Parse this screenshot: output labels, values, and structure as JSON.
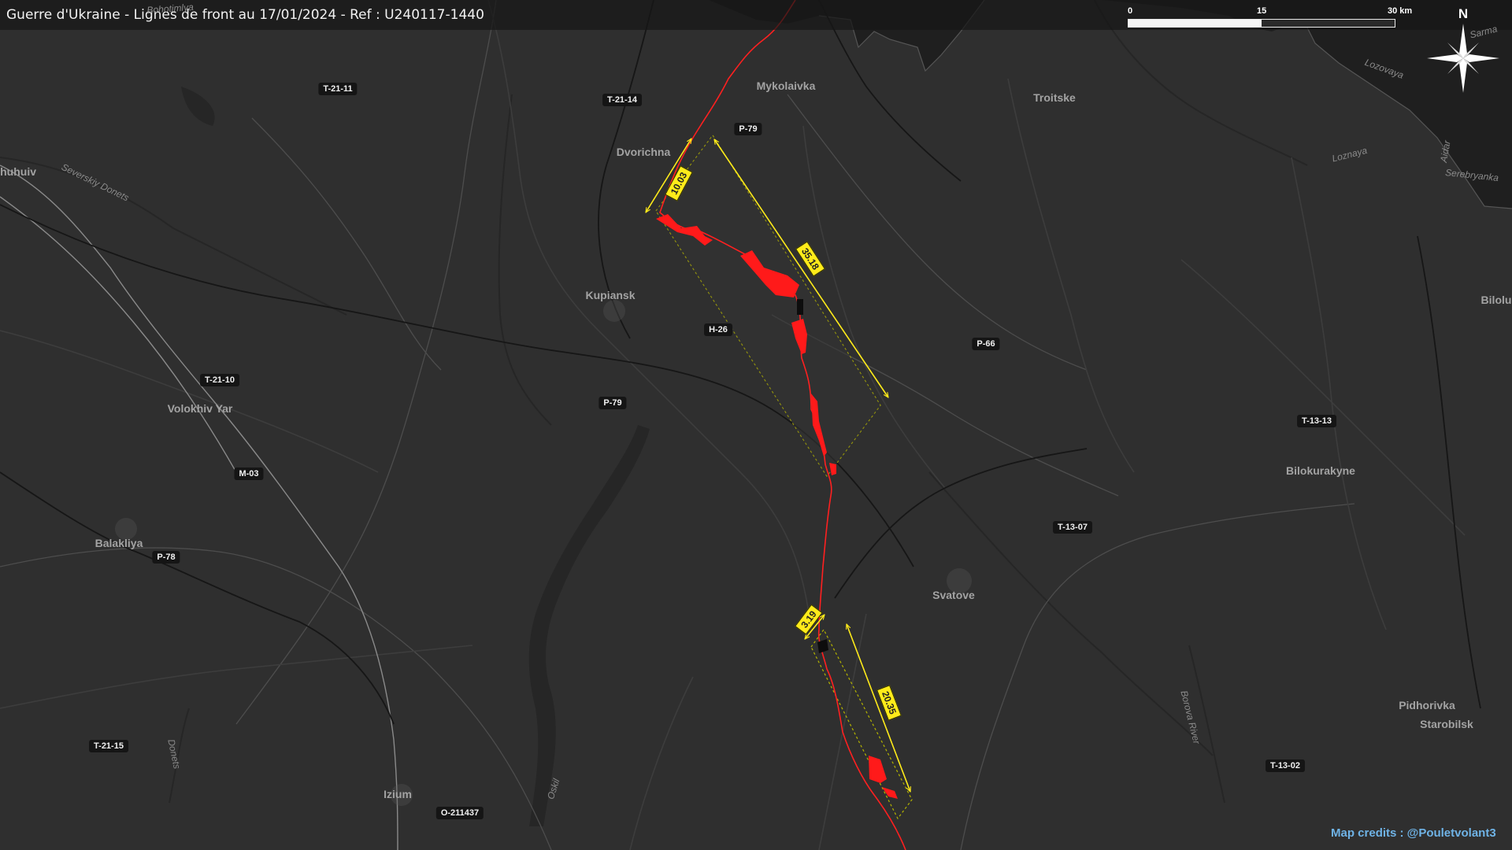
{
  "header": {
    "title": "Guerre d'Ukraine - Lignes de front au 17/01/2024 - Ref : U240117-1440"
  },
  "scale": {
    "labels": [
      "0",
      "15",
      "30 km"
    ],
    "filled_fraction": 0.5
  },
  "compass": {
    "north_label": "N",
    "icon": "compass-rose-icon"
  },
  "colors": {
    "background": "#2f2f2f",
    "front_line": "#ff2020",
    "measure": "#ffeb1a",
    "credits": "#6fb3e6"
  },
  "places": [
    {
      "id": "mykolaivka",
      "name": "Mykolaivka"
    },
    {
      "id": "troitske",
      "name": "Troitske"
    },
    {
      "id": "dvorichna",
      "name": "Dvorichna"
    },
    {
      "id": "kupiansk",
      "name": "Kupiansk"
    },
    {
      "id": "volokhiv-yar",
      "name": "Volokhiv Yar"
    },
    {
      "id": "balakliya",
      "name": "Balakliya"
    },
    {
      "id": "izium",
      "name": "Izium"
    },
    {
      "id": "svatove",
      "name": "Svatove"
    },
    {
      "id": "bilokurakyne",
      "name": "Bilokurakyne"
    },
    {
      "id": "pidhorivka",
      "name": "Pidhorivka"
    },
    {
      "id": "starobilsk",
      "name": "Starobilsk"
    },
    {
      "id": "chuhuiv",
      "name": "Chuhuiv"
    },
    {
      "id": "bilolutsk",
      "name": "Bilolu"
    }
  ],
  "rivers": [
    {
      "id": "seversky-donets",
      "name": "Severskiy Donets"
    },
    {
      "id": "lozovaya",
      "name": "Lozovaya"
    },
    {
      "id": "loznaya",
      "name": "Loznaya"
    },
    {
      "id": "aidar",
      "name": "Aidar"
    },
    {
      "id": "serebryanka",
      "name": "Serebryanka"
    },
    {
      "id": "sarma",
      "name": "Sarma"
    },
    {
      "id": "borova",
      "name": "Borova River"
    },
    {
      "id": "oskil",
      "name": "Oskil"
    },
    {
      "id": "donets",
      "name": "Donets"
    },
    {
      "id": "bohotimlya",
      "name": "Bohotimlya"
    }
  ],
  "roads": [
    {
      "id": "t-21-11",
      "label": "T-21-11"
    },
    {
      "id": "t-21-14",
      "label": "T-21-14"
    },
    {
      "id": "p-79-north",
      "label": "P-79"
    },
    {
      "id": "h-26",
      "label": "H-26"
    },
    {
      "id": "p-79-south",
      "label": "P-79"
    },
    {
      "id": "p-66",
      "label": "P-66"
    },
    {
      "id": "t-21-10",
      "label": "T-21-10"
    },
    {
      "id": "m-03",
      "label": "M-03"
    },
    {
      "id": "p-78",
      "label": "P-78"
    },
    {
      "id": "t-21-15",
      "label": "T-21-15"
    },
    {
      "id": "o-211437",
      "label": "O-211437"
    },
    {
      "id": "t-13-13",
      "label": "T-13-13"
    },
    {
      "id": "t-13-07",
      "label": "T-13-07"
    },
    {
      "id": "t-13-02",
      "label": "T-13-02"
    }
  ],
  "measurements": [
    {
      "id": "m-north-width",
      "value": "10.03",
      "unit": "km"
    },
    {
      "id": "m-north-length",
      "value": "35.18",
      "unit": "km"
    },
    {
      "id": "m-south-width",
      "value": "3.19",
      "unit": "km"
    },
    {
      "id": "m-south-length",
      "value": "20.35",
      "unit": "km"
    }
  ],
  "credits": "Map credits : @Pouletvolant3"
}
